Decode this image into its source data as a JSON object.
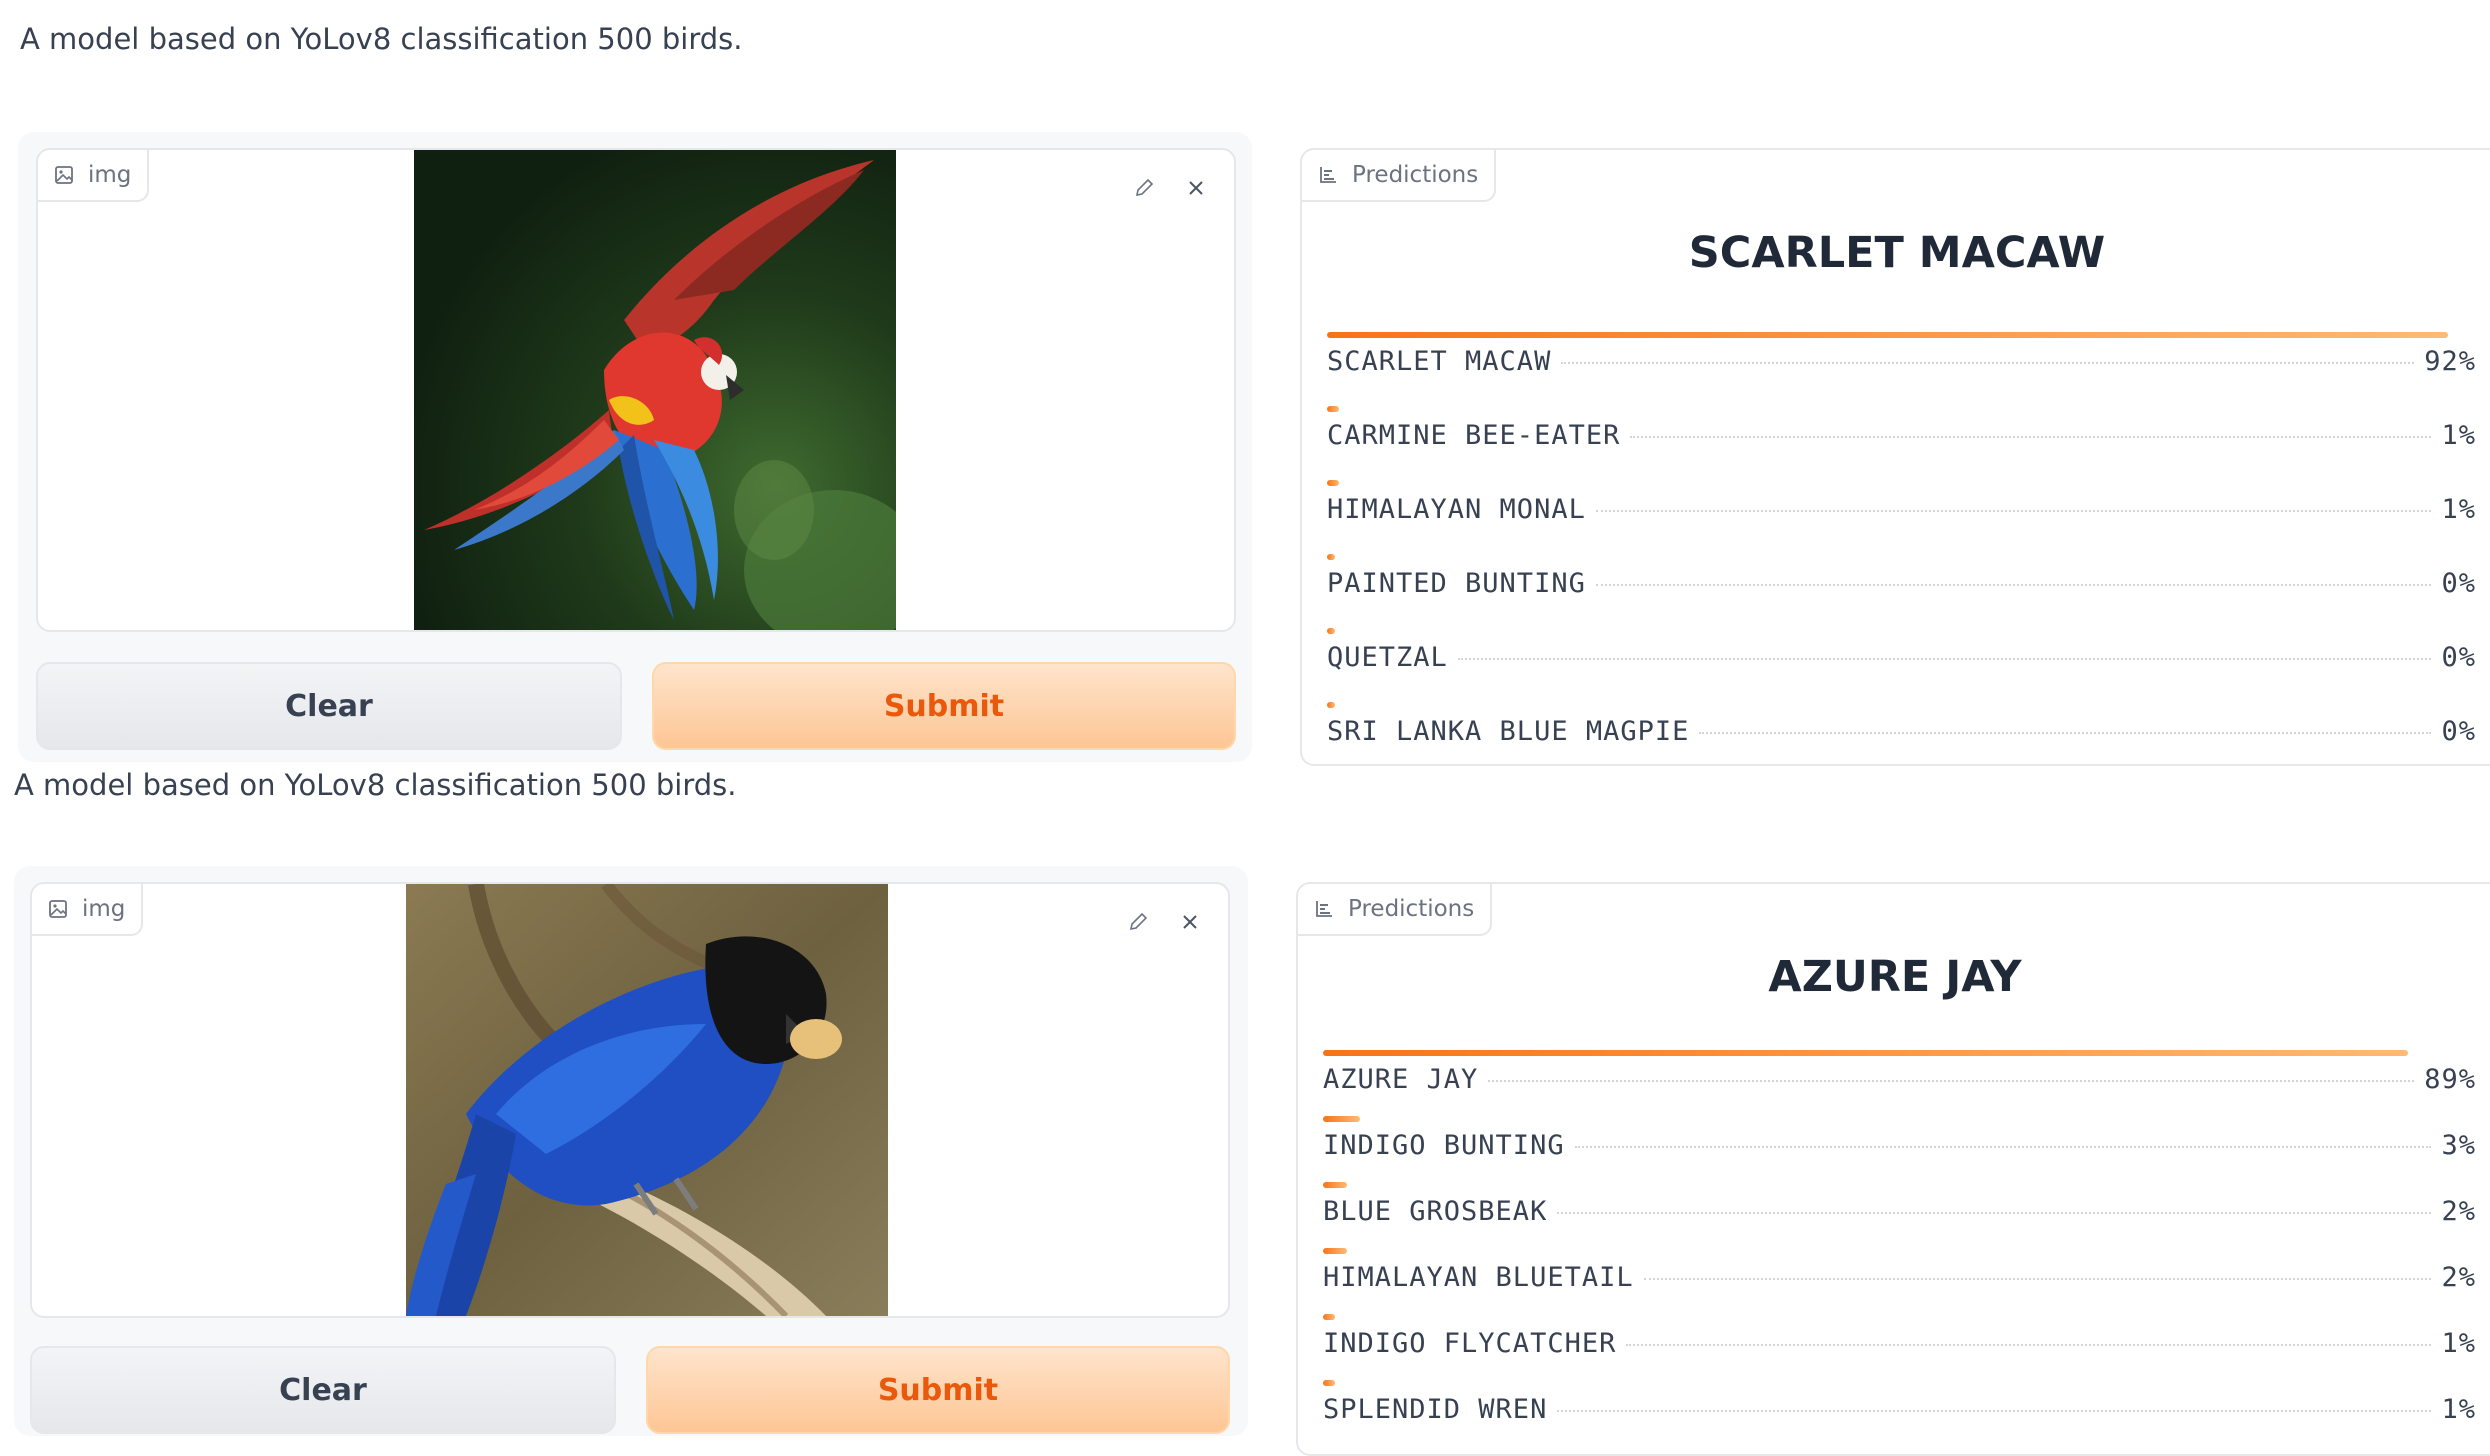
{
  "description": "A model based on YoLov8 classification 500 birds.",
  "image_label": "img",
  "predictions_label": "Predictions",
  "buttons": {
    "clear": "Clear",
    "submit": "Submit"
  },
  "icons": {
    "image": "image-icon",
    "edit": "pencil-icon",
    "close": "close-icon",
    "chart": "bar-chart-icon"
  },
  "colors": {
    "accent": "#f97316",
    "submit_bg": "#fdc694",
    "clear_bg": "#e5e7eb"
  },
  "examples": [
    {
      "top_label": "SCARLET MACAW",
      "image_subject": "scarlet macaw in flight",
      "confidences": [
        {
          "label": "SCARLET MACAW",
          "pct": "92%",
          "value": 0.92
        },
        {
          "label": "CARMINE BEE-EATER",
          "pct": "1%",
          "value": 0.01
        },
        {
          "label": "HIMALAYAN MONAL",
          "pct": "1%",
          "value": 0.01
        },
        {
          "label": "PAINTED BUNTING",
          "pct": "0%",
          "value": 0.004
        },
        {
          "label": "QUETZAL",
          "pct": "0%",
          "value": 0.004
        },
        {
          "label": "SRI LANKA BLUE MAGPIE",
          "pct": "0%",
          "value": 0.004
        }
      ]
    },
    {
      "top_label": "AZURE JAY",
      "image_subject": "blue jay perched on branch",
      "confidences": [
        {
          "label": "AZURE JAY",
          "pct": "89%",
          "value": 0.89
        },
        {
          "label": "INDIGO BUNTING",
          "pct": "3%",
          "value": 0.03
        },
        {
          "label": "BLUE GROSBEAK",
          "pct": "2%",
          "value": 0.02
        },
        {
          "label": "HIMALAYAN BLUETAIL",
          "pct": "2%",
          "value": 0.02
        },
        {
          "label": "INDIGO FLYCATCHER",
          "pct": "1%",
          "value": 0.01
        },
        {
          "label": "SPLENDID WREN",
          "pct": "1%",
          "value": 0.01
        }
      ]
    }
  ]
}
